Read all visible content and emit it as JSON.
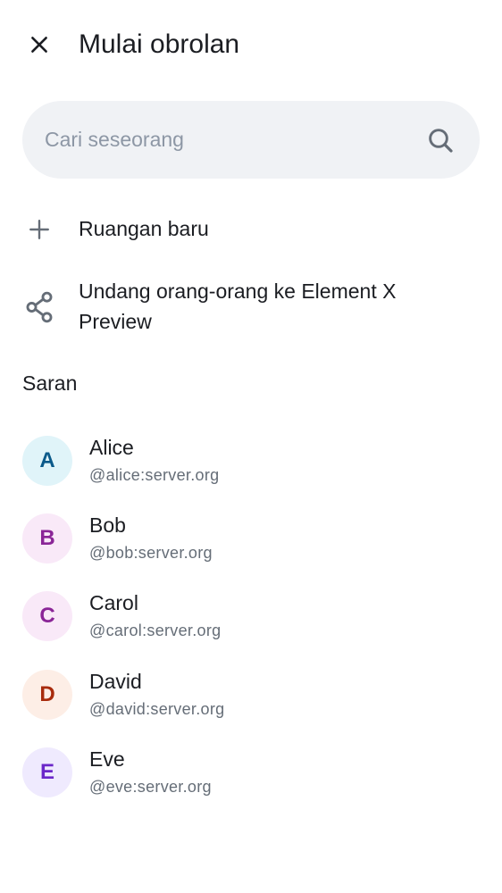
{
  "header": {
    "close_icon": "close-icon",
    "title": "Mulai obrolan"
  },
  "search": {
    "placeholder": "Cari seseorang",
    "value": "",
    "icon": "search-icon"
  },
  "actions": [
    {
      "icon": "plus-icon",
      "label": "Ruangan baru"
    },
    {
      "icon": "share-icon",
      "label_line1": "Undang orang-orang ke Element X",
      "label_line2": "Preview"
    }
  ],
  "suggestions": {
    "title": "Saran",
    "contacts": [
      {
        "initial": "A",
        "name": "Alice",
        "id": "@alice:server.org",
        "avatar_bg": "#e0f4f9",
        "avatar_fg": "#0b5a8a"
      },
      {
        "initial": "B",
        "name": "Bob",
        "id": "@bob:server.org",
        "avatar_bg": "#f9e9f8",
        "avatar_fg": "#8a2597"
      },
      {
        "initial": "C",
        "name": "Carol",
        "id": "@carol:server.org",
        "avatar_bg": "#f9e9f8",
        "avatar_fg": "#8a2597"
      },
      {
        "initial": "D",
        "name": "David",
        "id": "@david:server.org",
        "avatar_bg": "#fdeee6",
        "avatar_fg": "#a82b0c"
      },
      {
        "initial": "E",
        "name": "Eve",
        "id": "@eve:server.org",
        "avatar_bg": "#efeafe",
        "avatar_fg": "#6b27c9"
      }
    ]
  }
}
